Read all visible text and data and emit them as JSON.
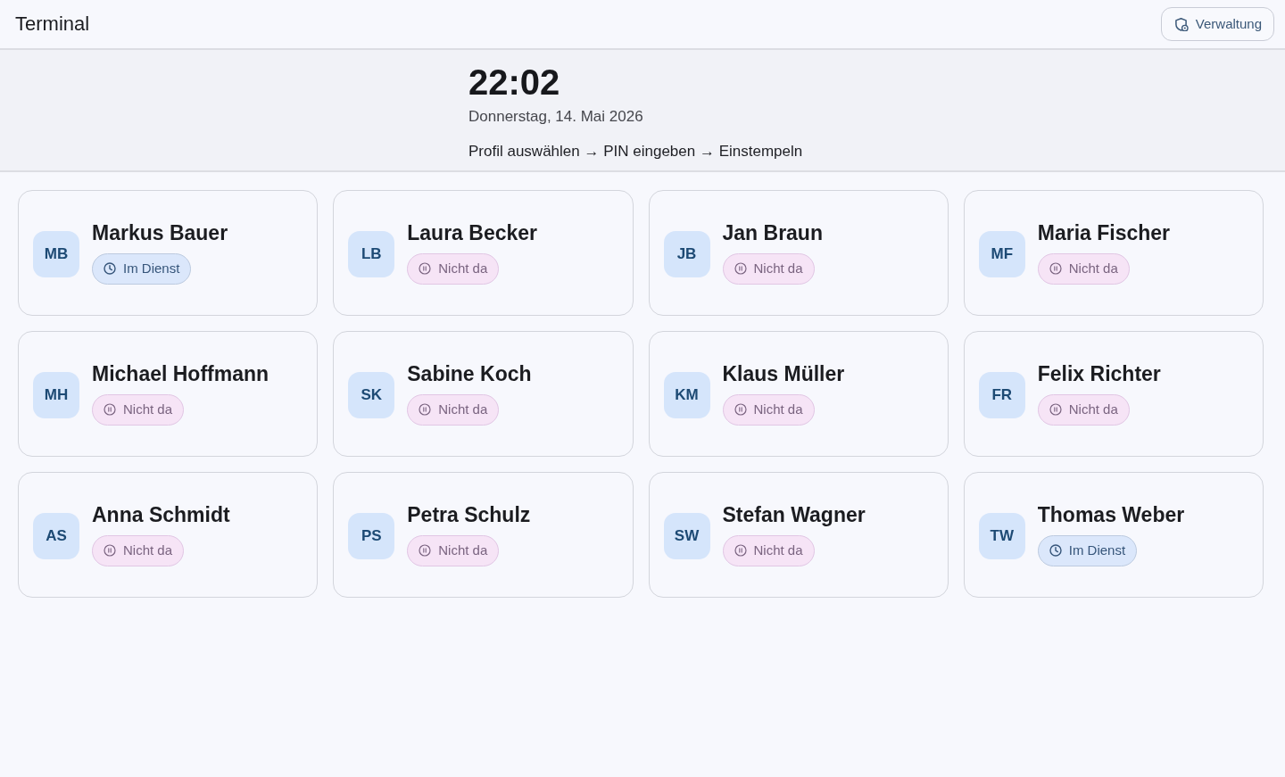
{
  "header": {
    "title": "Terminal",
    "admin_button": "Verwaltung"
  },
  "hero": {
    "time": "22:02",
    "date": "Donnerstag, 14. Mai 2026",
    "instructions": "Profil auswählen → PIN eingeben → Einstempeln"
  },
  "employees": [
    {
      "initials": "MB",
      "name": "Markus Bauer",
      "status": {
        "kind": "on_duty",
        "label": "Im Dienst"
      }
    },
    {
      "initials": "LB",
      "name": "Laura Becker",
      "status": {
        "kind": "absent",
        "label": "Nicht da"
      }
    },
    {
      "initials": "JB",
      "name": "Jan Braun",
      "status": {
        "kind": "absent",
        "label": "Nicht da"
      }
    },
    {
      "initials": "MF",
      "name": "Maria Fischer",
      "status": {
        "kind": "absent",
        "label": "Nicht da"
      }
    },
    {
      "initials": "MH",
      "name": "Michael Hoffmann",
      "status": {
        "kind": "absent",
        "label": "Nicht da"
      }
    },
    {
      "initials": "SK",
      "name": "Sabine Koch",
      "status": {
        "kind": "absent",
        "label": "Nicht da"
      }
    },
    {
      "initials": "KM",
      "name": "Klaus Müller",
      "status": {
        "kind": "absent",
        "label": "Nicht da"
      }
    },
    {
      "initials": "FR",
      "name": "Felix Richter",
      "status": {
        "kind": "absent",
        "label": "Nicht da"
      }
    },
    {
      "initials": "AS",
      "name": "Anna Schmidt",
      "status": {
        "kind": "absent",
        "label": "Nicht da"
      }
    },
    {
      "initials": "PS",
      "name": "Petra Schulz",
      "status": {
        "kind": "absent",
        "label": "Nicht da"
      }
    },
    {
      "initials": "SW",
      "name": "Stefan Wagner",
      "status": {
        "kind": "absent",
        "label": "Nicht da"
      }
    },
    {
      "initials": "TW",
      "name": "Thomas Weber",
      "status": {
        "kind": "on_duty",
        "label": "Im Dienst"
      }
    }
  ]
}
